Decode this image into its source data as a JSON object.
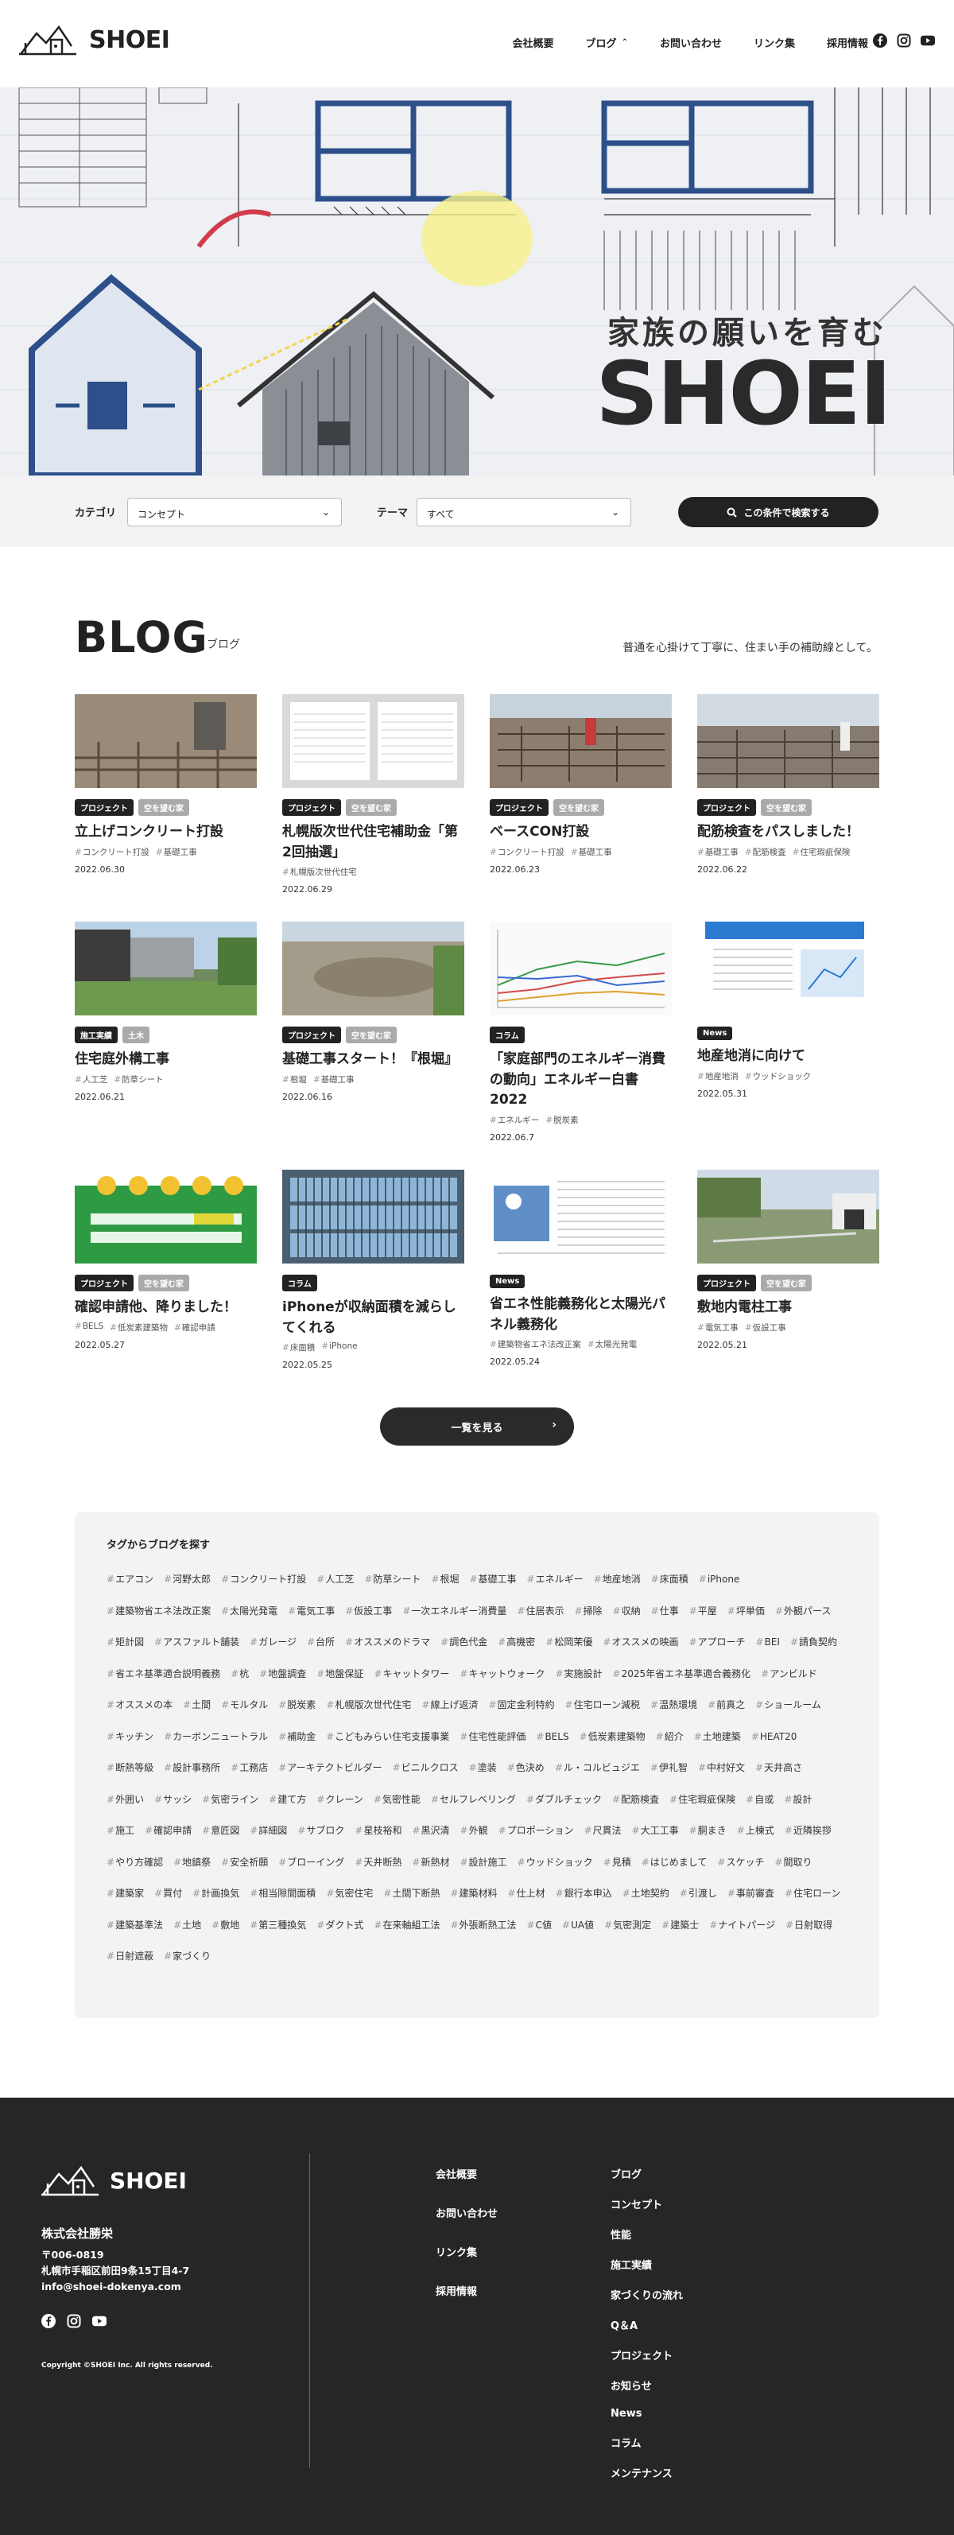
{
  "brand": {
    "logo_text": "SHOEI"
  },
  "nav": [
    {
      "label": "会社概要"
    },
    {
      "label": "ブログ"
    },
    {
      "label": "お問い合わせ"
    },
    {
      "label": "リンク集"
    },
    {
      "label": "採用情報"
    }
  ],
  "social_icons": [
    "facebook-icon",
    "instagram-icon",
    "youtube-icon"
  ],
  "hero": {
    "subtitle": "家族の願いを育む",
    "title": "SHOEI"
  },
  "filter": {
    "category_label": "カテゴリ",
    "category_value": "コンセプト",
    "theme_label": "テーマ",
    "theme_value": "すべて",
    "search_button": "この条件で検索する"
  },
  "blog": {
    "title": "BLOG",
    "title_ja": "ブログ",
    "lead": "普通を心掛けて丁寧に、住まい手の補助線として。"
  },
  "posts": [
    {
      "badges": [
        "プロジェクト",
        "空を望む家"
      ],
      "title": "立上げコンクリート打設",
      "tags": [
        "コンクリート打設",
        "基礎工事"
      ],
      "date": "2022.06.30",
      "thumb_color": "#8a7a66"
    },
    {
      "badges": [
        "プロジェクト",
        "空を望む家"
      ],
      "title": "札幌版次世代住宅補助金「第2回抽選」",
      "tags": [
        "札幌版次世代住宅"
      ],
      "date": "2022.06.29",
      "thumb_color": "#e8e8ea"
    },
    {
      "badges": [
        "プロジェクト",
        "空を望む家"
      ],
      "title": "ベースCON打設",
      "tags": [
        "コンクリート打設",
        "基礎工事"
      ],
      "date": "2022.06.23",
      "thumb_color": "#8c7d6e"
    },
    {
      "badges": [
        "プロジェクト",
        "空を望む家"
      ],
      "title": "配筋検査をパスしました！",
      "tags": [
        "基礎工事",
        "配筋検査",
        "住宅瑕疵保険"
      ],
      "date": "2022.06.22",
      "thumb_color": "#867b70"
    },
    {
      "badges": [
        "施工実績",
        "土木"
      ],
      "title": "住宅庭外構工事",
      "tags": [
        "人工芝",
        "防草シート"
      ],
      "date": "2022.06.21",
      "thumb_color": "#6f8a5e"
    },
    {
      "badges": [
        "プロジェクト",
        "空を望む家"
      ],
      "title": "基礎工事スタート！『根堀』",
      "tags": [
        "根堀",
        "基礎工事"
      ],
      "date": "2022.06.16",
      "thumb_color": "#9a9484"
    },
    {
      "badges": [
        "コラム"
      ],
      "title": "「家庭部門のエネルギー消費の動向」エネルギー白書2022",
      "tags": [
        "エネルギー",
        "脱炭素"
      ],
      "date": "2022.06.7",
      "thumb_color": "#f4f6f4"
    },
    {
      "badges": [
        "News"
      ],
      "title": "地産地消に向けて",
      "tags": [
        "地産地消",
        "ウッドショック"
      ],
      "date": "2022.05.31",
      "thumb_color": "#f2f4f8"
    },
    {
      "badges": [
        "プロジェクト",
        "空を望む家"
      ],
      "title": "確認申請他、降りました！",
      "tags": [
        "BELS",
        "低炭素建築物",
        "確認申請"
      ],
      "date": "2022.05.27",
      "thumb_color": "#3d9a4a"
    },
    {
      "badges": [
        "コラム"
      ],
      "title": "iPhoneが収納面積を減らしてくれる",
      "tags": [
        "床面積",
        "iPhone"
      ],
      "date": "2022.05.25",
      "thumb_color": "#5f7f98"
    },
    {
      "badges": [
        "News"
      ],
      "title": "省エネ性能義務化と太陽光パネル義務化",
      "tags": [
        "建築物省エネ法改正案",
        "太陽光発電"
      ],
      "date": "2022.05.24",
      "thumb_color": "#f6f6f6"
    },
    {
      "badges": [
        "プロジェクト",
        "空を望む家"
      ],
      "title": "敷地内電柱工事",
      "tags": [
        "電気工事",
        "仮設工事"
      ],
      "date": "2022.05.21",
      "thumb_color": "#7d8f6c"
    }
  ],
  "more_button": "一覧を見る",
  "tag_section": {
    "title": "タグからブログを探す",
    "tags": [
      "エアコン",
      "河野太郎",
      "コンクリート打設",
      "人工芝",
      "防草シート",
      "根堀",
      "基礎工事",
      "エネルギー",
      "地産地消",
      "床面積",
      "iPhone",
      "建築物省エネ法改正案",
      "太陽光発電",
      "電気工事",
      "仮設工事",
      "一次エネルギー消費量",
      "住居表示",
      "掃除",
      "収納",
      "仕事",
      "平屋",
      "坪単価",
      "外観パース",
      "矩計図",
      "アスファルト舗装",
      "ガレージ",
      "台所",
      "オススメのドラマ",
      "調色代金",
      "高機密",
      "松岡茉優",
      "オススメの映画",
      "アプローチ",
      "BEI",
      "請負契約",
      "省エネ基準適合説明義務",
      "杭",
      "地盤調査",
      "地盤保証",
      "キャットタワー",
      "キャットウォーク",
      "実施設計",
      "2025年省エネ基準適合義務化",
      "アンビルド",
      "オススメの本",
      "土間",
      "モルタル",
      "脱炭素",
      "札幌版次世代住宅",
      "線上げ返済",
      "固定金利特約",
      "住宅ローン減税",
      "温熱環境",
      "前真之",
      "ショールーム",
      "キッチン",
      "カーボンニュートラル",
      "補助金",
      "こどもみらい住宅支援事業",
      "住宅性能評価",
      "BELS",
      "低炭素建築物",
      "紹介",
      "土地建築",
      "HEAT20",
      "断熱等級",
      "設計事務所",
      "工務店",
      "アーキテクトビルダー",
      "ビニルクロス",
      "塗装",
      "色決め",
      "ル・コルビュジエ",
      "伊礼智",
      "中村好文",
      "天井高さ",
      "外囲い",
      "サッシ",
      "気密ライン",
      "建て方",
      "クレーン",
      "気密性能",
      "セルフレベリング",
      "ダブルチェック",
      "配筋検査",
      "住宅瑕疵保険",
      "自或",
      "設計",
      "施工",
      "確認申請",
      "意匠図",
      "詳細図",
      "サブロク",
      "星枝裕和",
      "黒沢清",
      "外観",
      "プロポーション",
      "尺貫法",
      "大工工事",
      "胴まき",
      "上棟式",
      "近隣挨拶",
      "やり方確認",
      "地鎮祭",
      "安全祈願",
      "ブローイング",
      "天井断熱",
      "新熱材",
      "設計施工",
      "ウッドショック",
      "見積",
      "はじめまして",
      "スケッチ",
      "間取り",
      "建築家",
      "買付",
      "計画換気",
      "相当隙間面積",
      "気密住宅",
      "土間下断熱",
      "建築材料",
      "仕上材",
      "銀行本申込",
      "土地契約",
      "引渡し",
      "事前審査",
      "住宅ローン",
      "建築基準法",
      "土地",
      "敷地",
      "第三種換気",
      "ダクト式",
      "在来軸組工法",
      "外張断熱工法",
      "C値",
      "UA値",
      "気密測定",
      "建築士",
      "ナイトパージ",
      "日射取得",
      "日射遮蔽",
      "家づくり"
    ]
  },
  "footer": {
    "logo_text": "SHOEI",
    "company": "株式会社勝栄",
    "postal": "〒006-0819",
    "address": "札幌市手稲区前田9条15丁目4-7",
    "email": "info@shoei-dokenya.com",
    "copyright": "Copyright ©SHOEI Inc. All rights reserved.",
    "nav_left": [
      "会社概要",
      "お問い合わせ",
      "リンク集",
      "採用情報"
    ],
    "nav_right": [
      "ブログ",
      "コンセプト",
      "性能",
      "施工実績",
      "家づくりの流れ",
      "Q＆A",
      "プロジェクト",
      "お知らせ",
      "News",
      "コラム",
      "メンテナンス"
    ]
  }
}
